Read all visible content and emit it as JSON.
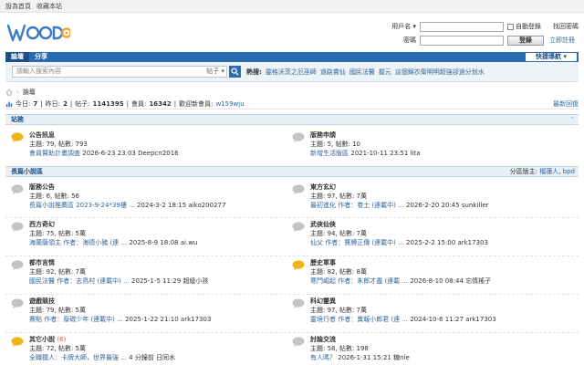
{
  "topbar": {
    "set_home": "設為首頁",
    "bookmark": "收藏本站"
  },
  "logo": {
    "text": "WOODO"
  },
  "login": {
    "user_label": "用戶名",
    "pass_label": "密碼",
    "remember": "自動登錄",
    "login_btn": "登錄",
    "find_pw": "找回密碼",
    "register": "立即註冊"
  },
  "nav": {
    "tabs": [
      "論壇",
      "分享"
    ],
    "quick": "快捷導航"
  },
  "search": {
    "placeholder": "請輸入搜索內容",
    "scope": "帖子",
    "hot_label": "熱搜:",
    "hot": [
      "靈格沃茨之厄巫師",
      "道路賞仙",
      "國民法醫",
      "握元",
      "這個錦衣衛明明超強卻過分划水"
    ]
  },
  "breadcrumb": {
    "current": "論壇"
  },
  "stats": {
    "today_label": "今日:",
    "today": "7",
    "yest_label": "昨日:",
    "yest": "2",
    "posts_label": "帖子:",
    "posts": "1141395",
    "members_label": "會員:",
    "members": "16342",
    "newest_label": "歡迎新會員:",
    "newest": "w159wju",
    "latest_reply": "最新回復"
  },
  "sections": [
    {
      "title": "站務"
    },
    {
      "title": "長篇小說區",
      "mods_label": "分區版主:",
      "mods": [
        "榴蓮人",
        "bpd"
      ]
    }
  ],
  "forums": [
    {
      "name": "公告訊息",
      "new": "",
      "meta": "主題: 79, 帖數: 793",
      "last_title": "會員贊助計畫調査",
      "last_time": "2026-6-23 23:03",
      "last_user": "Deepcn2016"
    },
    {
      "name": "版務申請",
      "new": "",
      "meta": "主題: 5, 帖數: 10",
      "last_title": "新增生活版區",
      "last_time": "2021-10-11 23:51",
      "last_user": "lita"
    },
    {
      "name": "版務公告",
      "new": "",
      "meta": "主題: 6, 帖數: 56",
      "last_title": "長篇小說推薦區 2023-9-24*39樓 ...",
      "last_time": "2024-3-2 18:15",
      "last_user": "aiko200277"
    },
    {
      "name": "東方玄幻",
      "new": "",
      "meta": "主題: 97, 帖數: 7萬",
      "last_title": "最初進化 作者：卷土 (連載中) ...",
      "last_time": "2026-2-20 20:45",
      "last_user": "sunkiller"
    },
    {
      "name": "西方奇幻",
      "new": "",
      "meta": "主題: 75, 帖數: 5萬",
      "last_title": "海蘭薩領主 作者：海德小豬 (連 ...",
      "last_time": "2025-8-9 18:08",
      "last_user": "ai.wu"
    },
    {
      "name": "武俠仙俠",
      "new": "",
      "meta": "主題: 94, 帖數: 7萬",
      "last_title": "仙父 作者：賈膊正傳 (連載中) ...",
      "last_time": "2025-2-2 15:00",
      "last_user": "ark17303"
    },
    {
      "name": "都市言情",
      "new": "",
      "meta": "主題: 92, 帖數: 7萬",
      "last_title": "國民法醫 作者：志鳥村 (連載中) ...",
      "last_time": "2025-1-5 11:29",
      "last_user": "超級小孩"
    },
    {
      "name": "歷史軍事",
      "new": "",
      "meta": "主題: 82, 帖數: 8萬",
      "last_title": "寒門崛起 作者：朱郎才盡 (連載 ...",
      "last_time": "2026-8-10 08:44",
      "last_user": "忘情搖子"
    },
    {
      "name": "遊戲競技",
      "new": "",
      "meta": "主題: 79, 帖數: 5萬",
      "last_title": "賽點 作者：廢碳少年 (連載中) ...",
      "last_time": "2025-1-22 21:10",
      "last_user": "ark17303"
    },
    {
      "name": "科幻靈異",
      "new": "",
      "meta": "主題: 97, 帖數: 7萬",
      "last_title": "靈境行者 作者：賣報小郎君 (連 ...",
      "last_time": "2024-10-6 11:27",
      "last_user": "ark17303"
    },
    {
      "name": "其它小說",
      "new": "(6)",
      "meta": "主題: 72, 帖數: 5萬",
      "last_title": "全職獵人：卡牌大師，世界最強 ...",
      "last_time": "4 分鐘前",
      "last_user": "日同水"
    },
    {
      "name": "討論交流",
      "new": "",
      "meta": "主題: 58, 帖數: 198",
      "last_title": "有人嗎？",
      "last_time": "2026-1-31 15:21",
      "last_user": "糖nie"
    }
  ],
  "colors": {
    "nav_blue": "#2b6cb0",
    "link": "#336699",
    "section_bg": "#e8eff6",
    "icon_new": "#f2b417",
    "icon_old": "#c4c4c4"
  }
}
